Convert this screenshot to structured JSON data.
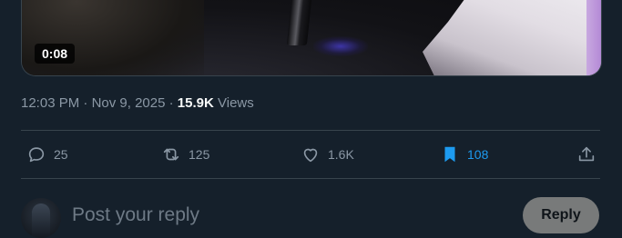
{
  "video": {
    "duration_label": "0:08"
  },
  "meta": {
    "time": "12:03 PM",
    "separator": " · ",
    "date": "Nov 9, 2025",
    "views_count": "15.9K",
    "views_label": "Views"
  },
  "actions": {
    "replies": {
      "icon": "comment-icon",
      "count": "25"
    },
    "reposts": {
      "icon": "repost-icon",
      "count": "125"
    },
    "likes": {
      "icon": "heart-icon",
      "count": "1.6K"
    },
    "bookmarks": {
      "icon": "bookmark-icon",
      "count": "108",
      "active": true,
      "color": "#1d9bf0"
    },
    "share": {
      "icon": "share-icon"
    }
  },
  "reply_box": {
    "placeholder": "Post your reply",
    "button_label": "Reply"
  },
  "colors": {
    "background": "#15202b",
    "muted_text": "#8b98a5",
    "accent": "#1d9bf0",
    "divider": "#38444d"
  }
}
